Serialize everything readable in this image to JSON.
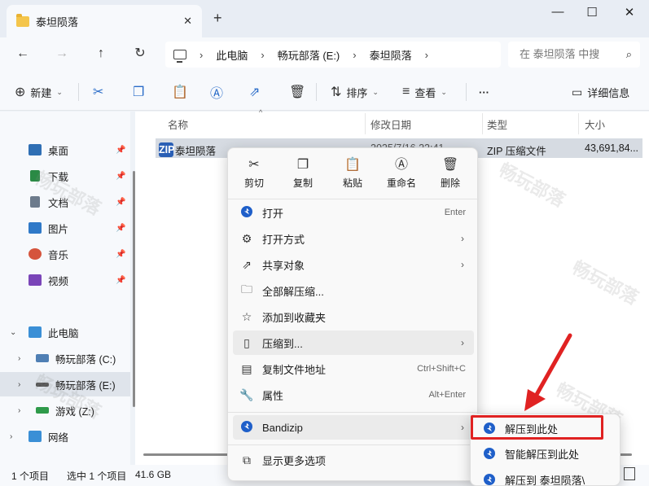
{
  "window": {
    "tab_title": "泰坦陨落",
    "new_tab": "+",
    "close_tab": "✕",
    "minimize": "—",
    "maximize": "☐",
    "close": "✕"
  },
  "address": {
    "crumbs": [
      "此电脑",
      "畅玩部落 (E:)",
      "泰坦陨落"
    ],
    "separator": "›",
    "search_placeholder": "在 泰坦陨落 中搜"
  },
  "toolbar": {
    "new_label": "新建",
    "sort_label": "排序",
    "view_label": "查看",
    "more_label": "···",
    "details_label": "详细信息"
  },
  "sidebar": {
    "quick": [
      {
        "label": "桌面",
        "icon": "desktop-icon",
        "color": "#2f6fb4"
      },
      {
        "label": "下载",
        "icon": "download-icon",
        "color": "#2a8a45"
      },
      {
        "label": "文档",
        "icon": "document-icon",
        "color": "#6d7b8c"
      },
      {
        "label": "图片",
        "icon": "picture-icon",
        "color": "#2f79c8"
      },
      {
        "label": "音乐",
        "icon": "music-icon",
        "color": "#d5543d"
      },
      {
        "label": "视频",
        "icon": "video-icon",
        "color": "#7a45b8"
      }
    ],
    "this_pc": "此电脑",
    "drives": [
      {
        "label": "畅玩部落 (C:)",
        "icon": "drive-c-icon"
      },
      {
        "label": "畅玩部落 (E:)",
        "icon": "drive-e-icon"
      },
      {
        "label": "游戏 (Z:)",
        "icon": "drive-z-icon"
      }
    ],
    "network": "网络"
  },
  "list": {
    "headers": {
      "name": "名称",
      "date": "修改日期",
      "type": "类型",
      "size": "大小"
    },
    "rows": [
      {
        "name": "泰坦陨落",
        "date": "2025/7/16 22:41",
        "type": "ZIP 压缩文件",
        "size": "43,691,84..."
      }
    ],
    "zip_badge": "ZIP"
  },
  "context_menu": {
    "top_actions": [
      {
        "label": "剪切",
        "icon": "scissors-icon"
      },
      {
        "label": "复制",
        "icon": "copy-icon"
      },
      {
        "label": "粘贴",
        "icon": "paste-icon"
      },
      {
        "label": "重命名",
        "icon": "rename-icon"
      },
      {
        "label": "删除",
        "icon": "delete-icon"
      }
    ],
    "items": [
      {
        "label": "打开",
        "shortcut": "Enter",
        "icon": "bandizip-icon",
        "arrow": ""
      },
      {
        "label": "打开方式",
        "shortcut": "",
        "icon": "open-with-icon",
        "arrow": "›"
      },
      {
        "label": "共享对象",
        "shortcut": "",
        "icon": "share-icon",
        "arrow": "›"
      },
      {
        "label": "全部解压缩...",
        "shortcut": "",
        "icon": "extract-all-icon",
        "arrow": ""
      },
      {
        "label": "添加到收藏夹",
        "shortcut": "",
        "icon": "star-icon",
        "arrow": ""
      },
      {
        "label": "压缩到...",
        "shortcut": "",
        "icon": "compress-icon",
        "arrow": "›"
      },
      {
        "label": "复制文件地址",
        "shortcut": "Ctrl+Shift+C",
        "icon": "copy-path-icon",
        "arrow": ""
      },
      {
        "label": "属性",
        "shortcut": "Alt+Enter",
        "icon": "properties-icon",
        "arrow": ""
      },
      {
        "label": "Bandizip",
        "shortcut": "",
        "icon": "bandizip-icon",
        "arrow": "›"
      },
      {
        "label": "显示更多选项",
        "shortcut": "",
        "icon": "more-options-icon",
        "arrow": ""
      }
    ]
  },
  "submenu": {
    "items": [
      "解压到此处",
      "智能解压到此处",
      "解压到 泰坦陨落\\"
    ]
  },
  "status": {
    "count": "1 个项目",
    "selected": "选中 1 个项目",
    "size": "41.6 GB"
  },
  "watermark": "畅玩部落",
  "colors": {
    "accent": "#2a6cc8",
    "highlight_box": "#e02222",
    "bandizip": "#1f5fc9"
  }
}
